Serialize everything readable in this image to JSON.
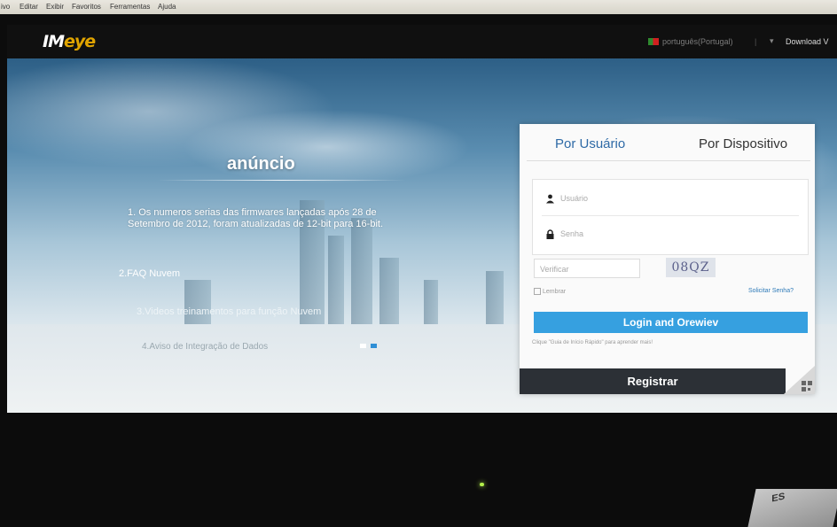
{
  "menubar": {
    "items": [
      "ivo",
      "Editar",
      "Exibir",
      "Favoritos",
      "Ferramentas",
      "Ajuda"
    ]
  },
  "header": {
    "logo_prefix": "IM",
    "logo_suffix": "eye",
    "language": "português(Portugal)",
    "separator": "|",
    "download": "Download V"
  },
  "announcement": {
    "title": "anúncio",
    "items": [
      "1. Os numeros serias das firmwares lançadas após 28 de Setembro de 2012, foram atualizadas de 12-bit para 16-bit.",
      "2.FAQ Nuvem",
      "3.Videos treinamentos para função Nuvem",
      "4.Aviso de Integração de Dados"
    ]
  },
  "login": {
    "tabs": [
      "Por Usuário",
      "Por Dispositivo"
    ],
    "username_placeholder": "Usuário",
    "password_placeholder": "Senha",
    "verify_placeholder": "Verificar",
    "captcha": "08QZ",
    "remember": "Lembrar",
    "forgot": "Solicitar Senha?",
    "login_button": "Login and Orewiev",
    "hint": "Clique \"Guia de Início Rápido\" para aprender mais!",
    "register_button": "Registrar"
  },
  "photo": {
    "paper_text": "ES"
  },
  "colors": {
    "accent": "#36a0e0",
    "tab_active": "#2e6aa6",
    "register_bg": "#2c3036"
  }
}
